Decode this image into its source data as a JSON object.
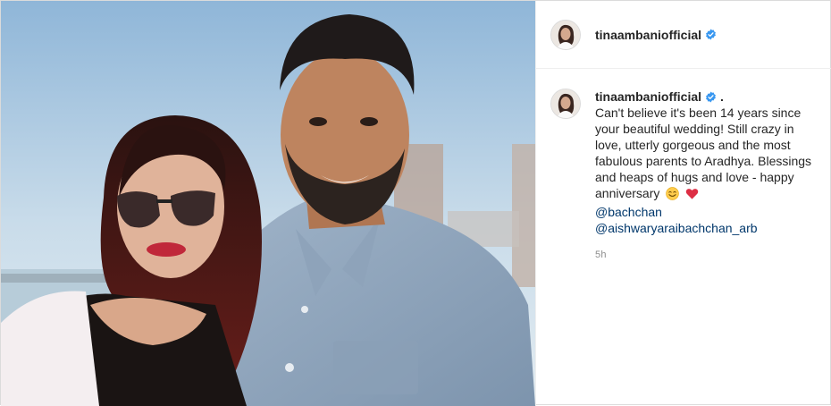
{
  "post": {
    "username": "tinaambaniofficial",
    "caption": {
      "author": "tinaambaniofficial",
      "separator": ".",
      "text": "Can't believe it's been 14 years since your beautiful wedding! Still crazy in love, utterly gorgeous and the most fabulous parents to Aradhya. Blessings and heaps of hugs and love - happy anniversary",
      "emojis": [
        "smiling-face-emoji",
        "red-heart-emoji"
      ],
      "mentions": [
        "@bachchan",
        "@aishwaryaraibachchan_arb"
      ],
      "time": "5h"
    },
    "colors": {
      "verified": "#3897f0",
      "mention": "#00376b",
      "muted": "#8e8e8e"
    }
  }
}
